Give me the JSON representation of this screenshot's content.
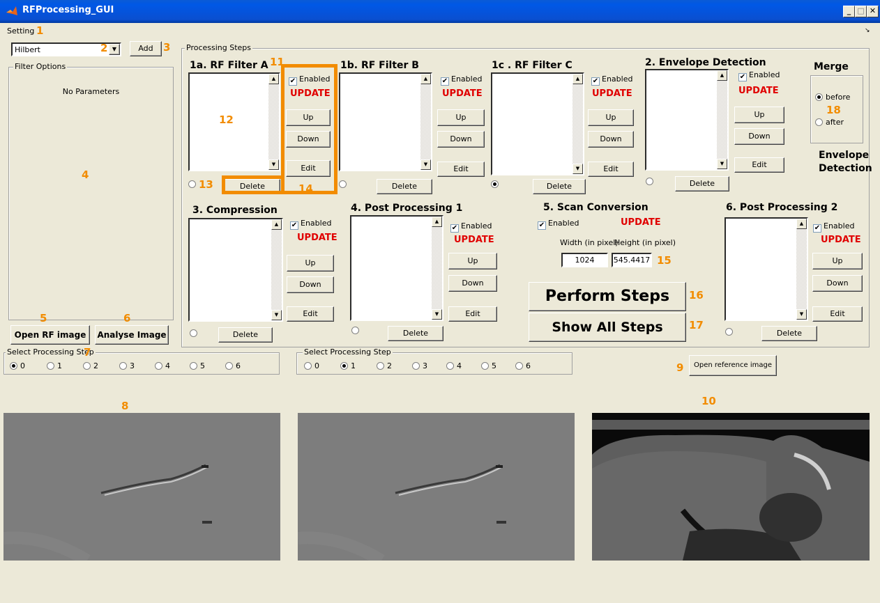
{
  "window": {
    "title": "RFProcessing_GUI",
    "minimize": "_",
    "maximize": "□",
    "close": "✕"
  },
  "menu": {
    "setting": "Setting"
  },
  "filter_select": {
    "value": "Hilbert",
    "add": "Add"
  },
  "filter_options": {
    "title": "Filter Options",
    "text": "No Parameters"
  },
  "open_rf": "Open RF image",
  "analyse": "Analyse Image",
  "processing_title": "Processing Steps",
  "common": {
    "enabled": "Enabled",
    "update": "UPDATE",
    "up": "Up",
    "down": "Down",
    "edit": "Edit",
    "delete": "Delete"
  },
  "steps": {
    "a": "1a. RF Filter A",
    "b": "1b. RF Filter B",
    "c": "1c . RF Filter C",
    "env": "2. Envelope Detection",
    "comp": "3. Compression",
    "pp1": "4. Post Processing 1",
    "scan": "5. Scan Conversion",
    "pp2": "6. Post Processing 2"
  },
  "merge": {
    "title": "Merge",
    "before": "before",
    "after": "after",
    "footer1": "Envelope",
    "footer2": "Detection"
  },
  "scan": {
    "width_label": "Width (in pixel)",
    "height_label": "Height (in pixel)",
    "width": "1024",
    "height": "545.4417"
  },
  "perform": "Perform Steps",
  "showall": "Show All Steps",
  "select1": {
    "title": "Select Processing Step",
    "options": [
      "0",
      "1",
      "2",
      "3",
      "4",
      "5",
      "6"
    ],
    "selected": "0"
  },
  "select2": {
    "title": "Select Processing Step",
    "options": [
      "0",
      "1",
      "2",
      "3",
      "4",
      "5",
      "6"
    ],
    "selected": "1"
  },
  "open_ref": "Open reference image",
  "annotations": {
    "a1": "1",
    "a2": "2",
    "a3": "3",
    "a4": "4",
    "a5": "5",
    "a6": "6",
    "a7": "7",
    "a8": "8",
    "a9": "9",
    "a10": "10",
    "a11": "11",
    "a12": "12",
    "a13": "13",
    "a14": "14",
    "a15": "15",
    "a16": "16",
    "a17": "17",
    "a18": "18"
  },
  "colors": {
    "titlebar": "#0058e6",
    "face": "#ece9d8",
    "update": "#e00000",
    "annotation": "#f28c00"
  }
}
